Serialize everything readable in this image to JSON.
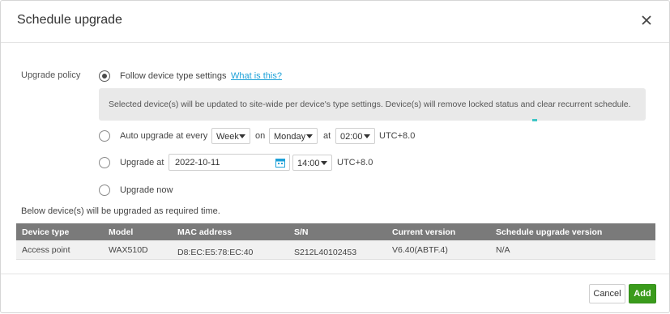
{
  "dialog": {
    "title": "Schedule upgrade",
    "close_icon": "close-icon"
  },
  "policy": {
    "label": "Upgrade policy",
    "options": [
      {
        "label": "Follow device type settings",
        "selected": true
      },
      {
        "label": "Auto upgrade at every",
        "selected": false
      },
      {
        "label": "Upgrade at",
        "selected": false
      },
      {
        "label": "Upgrade now",
        "selected": false
      }
    ],
    "help_link": "What is this?",
    "info_text": "Selected device(s) will be updated to site-wide per device's type settings. Device(s) will remove locked status and clear recurrent schedule."
  },
  "auto": {
    "frequency": "Week",
    "on_label": "on",
    "day": "Monday",
    "at_label": "at",
    "time": "02:00",
    "tz": "UTC+8.0"
  },
  "upgrade_at": {
    "date": "2022-10-11",
    "time": "14:00",
    "tz": "UTC+8.0",
    "calendar_icon": "calendar-icon"
  },
  "devices_note": "Below device(s) will be upgraded as required time.",
  "table": {
    "headers": [
      "Device type",
      "Model",
      "MAC address",
      "S/N",
      "Current version",
      "Schedule upgrade version"
    ],
    "rows": [
      [
        "Access point",
        "WAX510D",
        "D8:EC:E5:78:EC:40",
        "S212L40102453",
        "V6.40(ABTF.4)",
        "N/A"
      ]
    ]
  },
  "footer": {
    "cancel_label": "Cancel",
    "add_label": "Add"
  },
  "colors": {
    "accent_green": "#3a9b1c",
    "link_blue": "#1da1d8",
    "table_header": "#7a7a7a"
  }
}
